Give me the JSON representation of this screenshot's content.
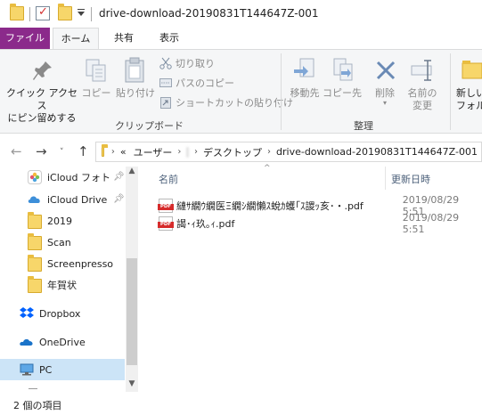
{
  "window": {
    "title": "drive-download-20190831T144647Z-001"
  },
  "tabs": {
    "file": "ファイル",
    "home": "ホーム",
    "share": "共有",
    "view": "表示"
  },
  "ribbon": {
    "pin_label_1": "クイック アクセス",
    "pin_label_2": "にピン留めする",
    "copy": "コピー",
    "paste": "貼り付け",
    "cut": "切り取り",
    "copy_path": "パスのコピー",
    "paste_shortcut": "ショートカットの貼り付け",
    "clipboard_group": "クリップボード",
    "move_to": "移動先",
    "copy_to": "コピー先",
    "delete": "削除",
    "rename_1": "名前の",
    "rename_2": "変更",
    "organize_group": "整理",
    "new_folder_1": "新しい",
    "new_folder_2": "フォルダー"
  },
  "address": {
    "overflow": "«",
    "crumbs": [
      "ユーザー",
      "デスクトップ",
      "drive-download-20190831T144647Z-001"
    ]
  },
  "nav_pane": {
    "items": [
      {
        "label": "iCloud フォト",
        "icon": "icloud-photos-icon",
        "pinned": true
      },
      {
        "label": "iCloud Drive",
        "icon": "icloud-drive-icon",
        "pinned": true
      },
      {
        "label": "2019",
        "icon": "folder-icon"
      },
      {
        "label": "Scan",
        "icon": "folder-icon"
      },
      {
        "label": "Screenpresso",
        "icon": "folder-icon"
      },
      {
        "label": "年賀状",
        "icon": "folder-icon"
      },
      {
        "label": "Dropbox",
        "icon": "dropbox-icon"
      },
      {
        "label": "OneDrive",
        "icon": "onedrive-icon"
      },
      {
        "label": "PC",
        "icon": "pc-icon",
        "selected": true
      }
    ]
  },
  "file_list": {
    "columns": {
      "name": "名前",
      "date": "更新日時"
    },
    "files": [
      {
        "name": "縺ｻ繝ｳ繝医Ξ繝ｼ繝懶ｽ蛻ｶ蠖｢ｽ謖ｯ亥･・.pdf",
        "date": "2019/08/29 5:51"
      },
      {
        "name": "謁･ｨ玖｡ｨ.pdf",
        "date": "2019/08/29 5:51"
      }
    ]
  },
  "status": {
    "count": "2 個の項目"
  },
  "colors": {
    "file_tab": "#8b2a8b",
    "selection": "#cce4f7",
    "folder": "#f7d66a"
  }
}
